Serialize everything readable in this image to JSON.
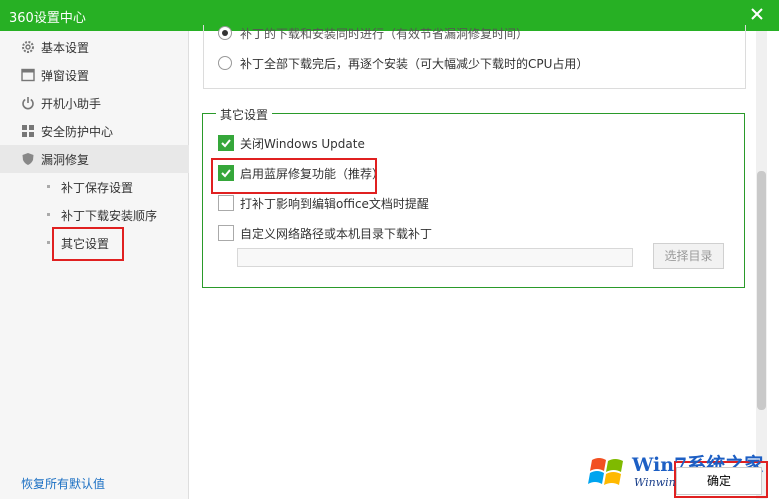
{
  "window": {
    "title": "360设置中心"
  },
  "sidebar": {
    "items": [
      {
        "label": "基本设置",
        "icon": "gear-icon"
      },
      {
        "label": "弹窗设置",
        "icon": "window-icon"
      },
      {
        "label": "开机小助手",
        "icon": "power-icon"
      },
      {
        "label": "安全防护中心",
        "icon": "grid-icon"
      },
      {
        "label": "漏洞修复",
        "icon": "shield-icon"
      }
    ],
    "subitems": [
      {
        "label": "补丁保存设置"
      },
      {
        "label": "补丁下载安装顺序"
      },
      {
        "label": "其它设置"
      }
    ],
    "restore_label": "恢复所有默认值"
  },
  "main": {
    "radio_options": [
      {
        "label": "补丁的下载和安装同时进行（有效节省漏洞修复时间）",
        "checked": true
      },
      {
        "label": "补丁全部下载完后，再逐个安装（可大幅减少下载时的CPU占用）",
        "checked": false
      }
    ],
    "group_title": "其它设置",
    "checkboxes": [
      {
        "label": "关闭Windows Update",
        "checked": true
      },
      {
        "label": "启用蓝屏修复功能（推荐）",
        "checked": true
      },
      {
        "label": "打补丁影响到编辑office文档时提醒",
        "checked": false
      },
      {
        "label": "自定义网络路径或本机目录下载补丁",
        "checked": false
      }
    ],
    "path_value": "",
    "select_dir_label": "选择目录"
  },
  "footer": {
    "confirm_label": "确定"
  },
  "watermark": {
    "text": "Win7系统之家",
    "url": "Winwin7.com"
  },
  "colors": {
    "titlebar": "#27b024",
    "accent": "#35a73a",
    "highlight": "#e02020",
    "link": "#1a6fc3"
  }
}
